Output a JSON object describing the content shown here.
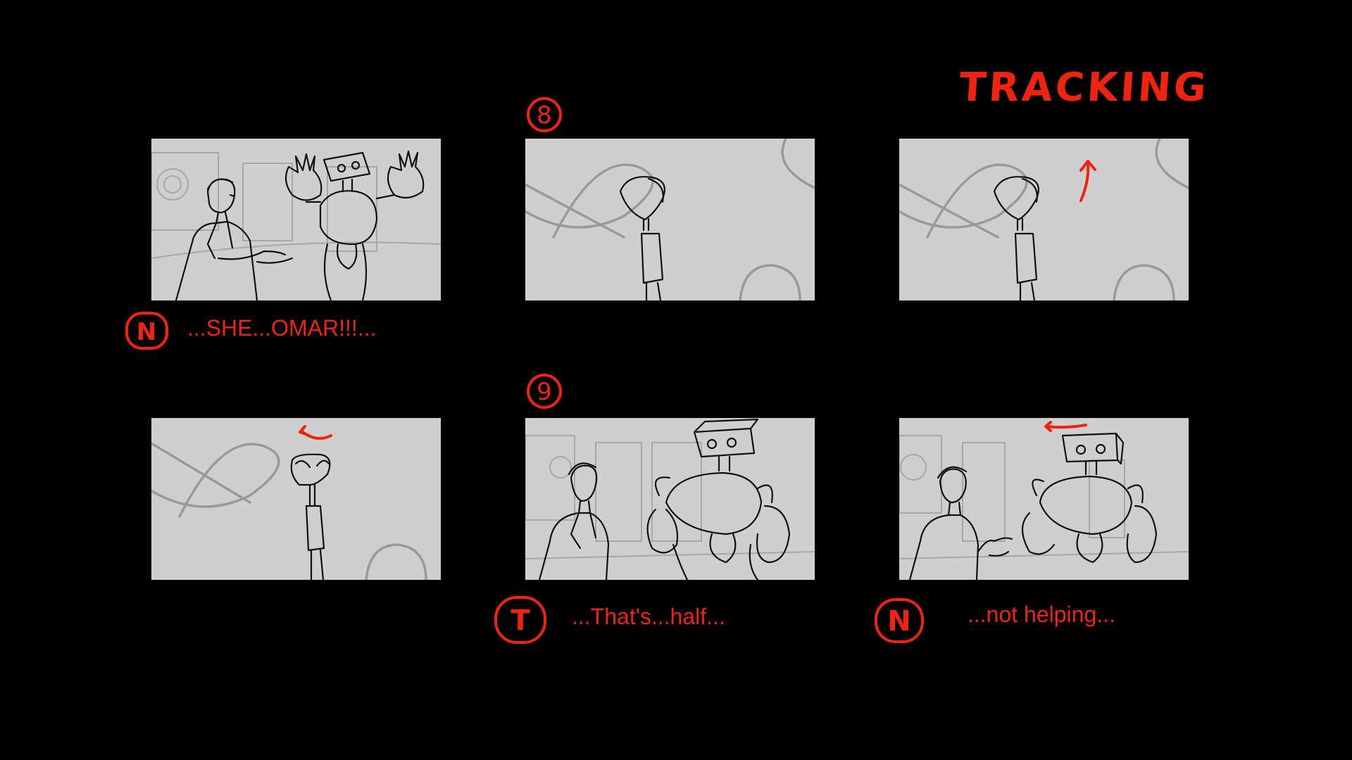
{
  "annotations": {
    "tracking": "TRACKING",
    "shot_8": "8",
    "shot_9": "9"
  },
  "captions": {
    "row1_left": {
      "badge": "N",
      "text": "...SHE...OMAR!!!..."
    },
    "row2_mid": {
      "badge": "T",
      "text": "...That's...half..."
    },
    "row2_right": {
      "badge": "N",
      "text": "...not helping..."
    }
  },
  "colors": {
    "background": "#000000",
    "panel": "#cfcfcf",
    "annotation_red": "#f0240e"
  }
}
